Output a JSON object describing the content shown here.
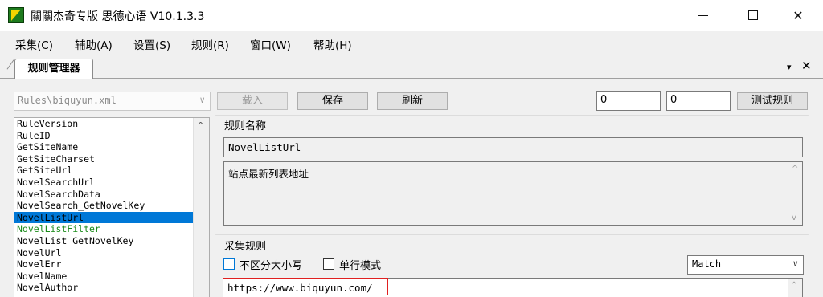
{
  "window": {
    "title": "關關杰奇专版 思德心语 V10.1.3.3",
    "minimize": "─",
    "maximize": "□",
    "close": "✕"
  },
  "menu": [
    "采集(C)",
    "辅助(A)",
    "设置(S)",
    "规则(R)",
    "窗口(W)",
    "帮助(H)"
  ],
  "doc_tab": {
    "label": "规则管理器",
    "dropdown_icon": "▾",
    "close_icon": "✕"
  },
  "left_panel": {
    "rule_file": "Rules\\biquyun.xml",
    "rule_file_arrow": "∨",
    "scroll_up": "^",
    "items": [
      "RuleVersion",
      "RuleID",
      "GetSiteName",
      "GetSiteCharset",
      "GetSiteUrl",
      "NovelSearchUrl",
      "NovelSearchData",
      "NovelSearch_GetNovelKey",
      "NovelListUrl",
      "NovelListFilter",
      "NovelList_GetNovelKey",
      "NovelUrl",
      "NovelErr",
      "NovelName",
      "NovelAuthor"
    ],
    "selected_index": 8,
    "highlight_index": 9,
    "highlight_color": "#1a8a1a",
    "selected_color": "#0078d7"
  },
  "toolbar": {
    "load_label": "载入",
    "save_label": "保存",
    "refresh_label": "刷新",
    "input1": "0",
    "input2": "0",
    "test_label": "测试规则"
  },
  "rule_name_group": {
    "label": "规则名称",
    "name_value": "NovelListUrl",
    "description": "站点最新列表地址",
    "scroll_up": "^",
    "scroll_down": "v"
  },
  "collect_group": {
    "label": "采集规则",
    "case_insensitive_label": "不区分大小写",
    "single_line_label": "单行模式",
    "match_mode": "Match",
    "match_arrow": "∨",
    "rule_value": "https://www.biquyun.com/",
    "scroll_up": "^"
  }
}
